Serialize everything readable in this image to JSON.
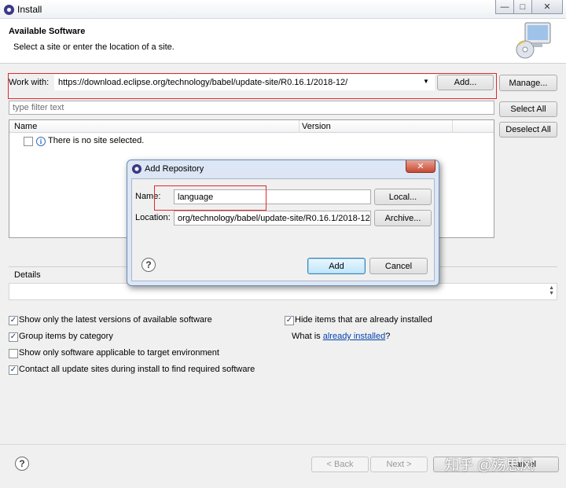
{
  "window": {
    "title": "Install",
    "minimize_glyph": "—",
    "maximize_glyph": "□",
    "close_glyph": "✕"
  },
  "header": {
    "title": "Available Software",
    "subtitle": "Select a site or enter the location of a site."
  },
  "work_with": {
    "label": "Work with:",
    "value": "https://download.eclipse.org/technology/babel/update-site/R0.16.1/2018-12/",
    "add_label": "Add...",
    "manage_label": "Manage..."
  },
  "filter": {
    "placeholder": "type filter text"
  },
  "buttons": {
    "select_all": "Select All",
    "deselect_all": "Deselect All"
  },
  "table": {
    "columns": [
      "Name",
      "Version"
    ],
    "empty_message": "There is no site selected."
  },
  "details": {
    "label": "Details"
  },
  "options": {
    "show_latest": {
      "label": "Show only the latest versions of available software",
      "checked": true
    },
    "hide_installed": {
      "label": "Hide items that are already installed",
      "checked": true
    },
    "group_by_category": {
      "label": "Group items by category",
      "checked": true
    },
    "what_is": "What is ",
    "already_installed_link": "already installed",
    "question_mark": "?",
    "target_env": {
      "label": "Show only software applicable to target environment",
      "checked": false
    },
    "contact_sites": {
      "label": "Contact all update sites during install to find required software",
      "checked": true
    }
  },
  "footer": {
    "back_label": "< Back",
    "next_label": "Next >",
    "cancel_label": "Cancel",
    "watermark": "知乎 @殇思风"
  },
  "dialog": {
    "title": "Add Repository",
    "close_glyph": "✕",
    "name_label": "Name:",
    "name_value": "language",
    "location_label": "Location:",
    "location_value": "org/technology/babel/update-site/R0.16.1/2018-12/",
    "local_label": "Local...",
    "archive_label": "Archive...",
    "add_label": "Add",
    "cancel_label": "Cancel"
  },
  "colors": {
    "highlight_red": "#e02a2a",
    "link_blue": "#0645ad",
    "dialog_frame": "#dce6f4"
  }
}
